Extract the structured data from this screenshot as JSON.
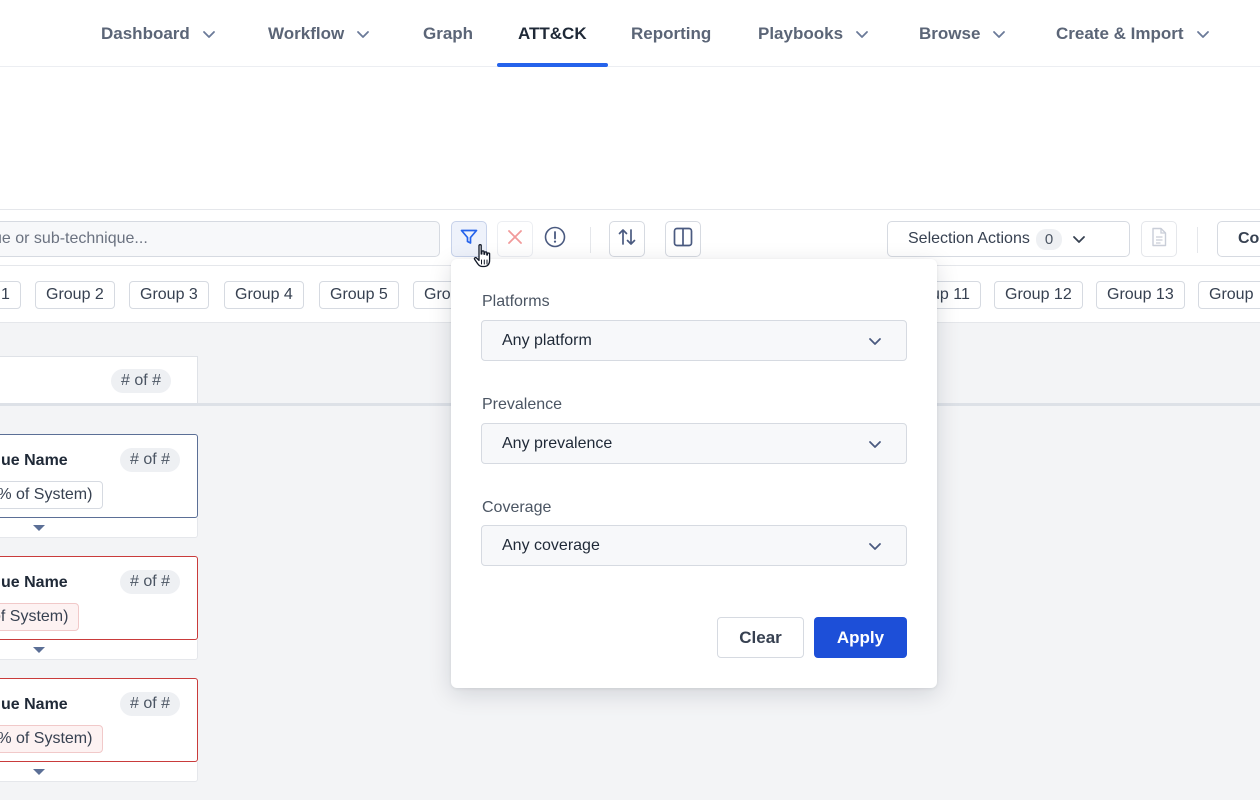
{
  "nav": {
    "items": [
      {
        "label": "Dashboard",
        "dropdown": true
      },
      {
        "label": "Workflow",
        "dropdown": true
      },
      {
        "label": "Graph",
        "dropdown": false
      },
      {
        "label": "ATT&CK",
        "dropdown": false,
        "active": true
      },
      {
        "label": "Reporting",
        "dropdown": false
      },
      {
        "label": "Playbooks",
        "dropdown": true
      },
      {
        "label": "Browse",
        "dropdown": true
      },
      {
        "label": "Create & Import",
        "dropdown": true
      }
    ]
  },
  "toolbar": {
    "search_placeholder": "ue or sub-technique...",
    "icons": [
      "filter-icon",
      "close-icon",
      "info-icon",
      "sort-icon",
      "columns-icon",
      "document-icon"
    ],
    "selection_actions_label": "Selection Actions",
    "selection_count": "0",
    "partial_button_label": "Co"
  },
  "groups": [
    "1",
    "Group 2",
    "Group 3",
    "Group 4",
    "Group 5",
    "Gro",
    "up 11",
    "Group 12",
    "Group 13",
    "Group"
  ],
  "matrix": {
    "column_count": "# of #",
    "cards": [
      {
        "name": "ue Name",
        "count": "# of #",
        "system": "(% of System)",
        "state": "default"
      },
      {
        "name": "ue Name",
        "count": "# of #",
        "system": "of System)",
        "state": "red"
      },
      {
        "name": "ue Name",
        "count": "# of #",
        "system": "(% of System)",
        "state": "red"
      }
    ]
  },
  "filter_panel": {
    "platforms_label": "Platforms",
    "platforms_value": "Any platform",
    "prevalence_label": "Prevalence",
    "prevalence_value": "Any prevalence",
    "coverage_label": "Coverage",
    "coverage_value": "Any coverage",
    "clear_label": "Clear",
    "apply_label": "Apply"
  },
  "colors": {
    "accent": "#2563eb",
    "apply_button": "#1d4fd8",
    "card_border_default": "#5b6f96",
    "card_border_alert": "#c93b3b",
    "close_icon": "#f19a9a"
  }
}
